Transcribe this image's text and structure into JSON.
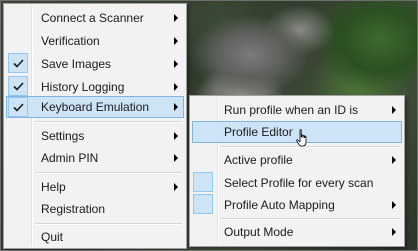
{
  "main_menu": {
    "items": [
      {
        "label": "Connect a Scanner",
        "checked": false,
        "submenu": true
      },
      {
        "label": "Verification",
        "checked": false,
        "submenu": true
      },
      {
        "label": "Save Images",
        "checked": true,
        "submenu": true
      },
      {
        "label": "History Logging",
        "checked": true,
        "submenu": true
      },
      {
        "label": "Keyboard Emulation",
        "checked": true,
        "submenu": true,
        "highlighted": true
      },
      {
        "label": "Settings",
        "checked": false,
        "submenu": true
      },
      {
        "label": "Admin PIN",
        "checked": false,
        "submenu": true
      },
      {
        "label": "Help",
        "checked": false,
        "submenu": true
      },
      {
        "label": "Registration",
        "checked": false,
        "submenu": false
      },
      {
        "label": "Quit",
        "checked": false,
        "submenu": false
      }
    ]
  },
  "submenu": {
    "items": [
      {
        "label": "Run profile when an ID is",
        "checked": false,
        "submenu": true
      },
      {
        "label": "Profile Editor",
        "checked": false,
        "submenu": false,
        "highlighted": true
      },
      {
        "label": "Active profile",
        "checked": false,
        "submenu": true
      },
      {
        "label": "Select Profile for every scan",
        "checked": false,
        "submenu": false,
        "box": true
      },
      {
        "label": "Profile Auto Mapping",
        "checked": false,
        "submenu": true,
        "box": true
      },
      {
        "label": "Output Mode",
        "checked": false,
        "submenu": true
      }
    ]
  },
  "colors": {
    "menu_bg": "#f2f2f2",
    "highlight": "#cde4f7",
    "highlight_border": "#7fb4e4",
    "check": "#1a1a1a"
  },
  "icons": {
    "check": "checkmark-icon",
    "submenu_arrow": "chevron-right-icon",
    "cursor": "mouse-pointer-icon"
  }
}
